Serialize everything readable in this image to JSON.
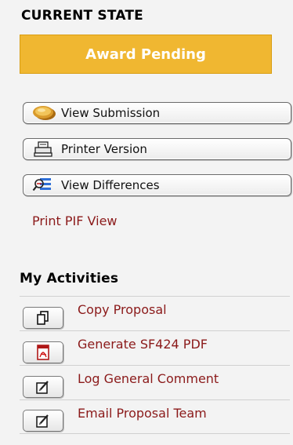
{
  "current_state": {
    "heading": "CURRENT STATE",
    "status": "Award Pending",
    "status_color": "#F0B731"
  },
  "actions": {
    "view_submission": {
      "label": "View Submission",
      "icon": "coin-icon"
    },
    "printer_version": {
      "label": "Printer Version",
      "icon": "printer-icon"
    },
    "view_differences": {
      "label": "View Differences",
      "icon": "compare-icon"
    },
    "print_pif_view": "Print PIF View"
  },
  "my_activities": {
    "heading": "My Activities",
    "items": [
      {
        "label": "Copy Proposal",
        "icon": "copy-icon"
      },
      {
        "label": "Generate SF424 PDF",
        "icon": "pdf-icon"
      },
      {
        "label": "Log General Comment",
        "icon": "edit-note-icon"
      },
      {
        "label": "Email Proposal Team",
        "icon": "edit-note-icon"
      }
    ]
  },
  "colors": {
    "link": "#8B1A1A",
    "panel_bg": "#F3F3F3"
  }
}
